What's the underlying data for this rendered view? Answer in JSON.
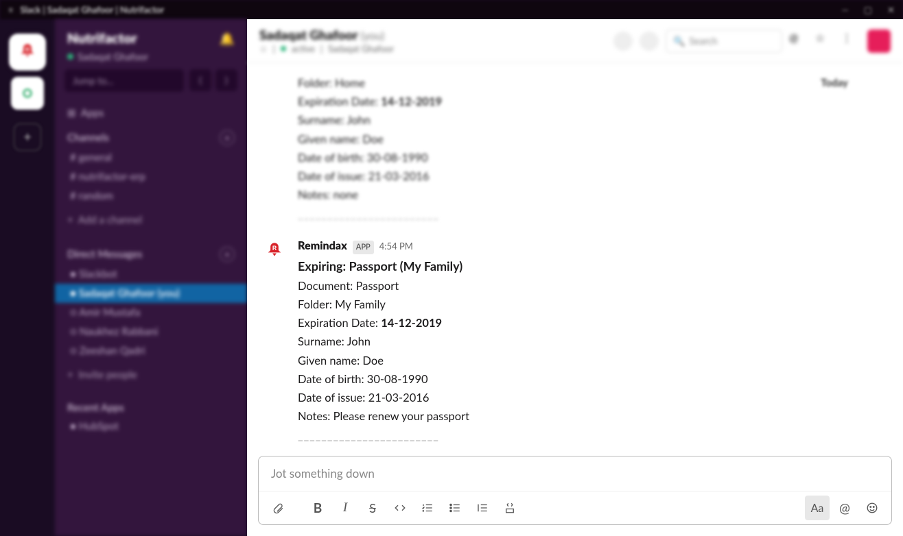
{
  "titlebar": {
    "text": "Slack | Sadaqat Ghafoor | Nutrifactor"
  },
  "workspace": {
    "name": "Nutrifactor",
    "user": "Sadaqat Ghafoor",
    "jump_placeholder": "Jump to...",
    "apps_label": "Apps"
  },
  "sidebar": {
    "channels_label": "Channels",
    "channels": [
      "general",
      "nutrifactor-erp",
      "random"
    ],
    "add_channel": "Add a channel",
    "dm_label": "Direct Messages",
    "dms": [
      {
        "name": "Slackbot",
        "presence": "active"
      },
      {
        "name": "Sadaqat Ghafoor",
        "suffix": "(you)",
        "selected": true,
        "presence": "active"
      },
      {
        "name": "Amir Mustafa",
        "presence": "away"
      },
      {
        "name": "Naukhez Rabbani",
        "presence": "away"
      },
      {
        "name": "Zeeshan Qadri",
        "presence": "away"
      }
    ],
    "invite": "Invite people",
    "recent_label": "Recent Apps",
    "recent": [
      "HubSpot"
    ]
  },
  "header": {
    "title": "Sadaqat Ghafoor",
    "you": "(you)",
    "status": "active",
    "subtitle": "Sadaqat Ghafoor",
    "search_placeholder": "Search"
  },
  "today_label": "Today",
  "prev_message": {
    "lines": [
      {
        "label": "Folder",
        "value": "Home"
      },
      {
        "label": "Expiration Date",
        "value": "14-12-2019",
        "bold_value": true
      },
      {
        "label": "Surname",
        "value": "John"
      },
      {
        "label": "Given name",
        "value": "Doe"
      },
      {
        "label": "Date of birth",
        "value": "30-08-1990"
      },
      {
        "label": "Date of issue",
        "value": "21-03-2016"
      },
      {
        "label": "Notes",
        "value": "none"
      }
    ],
    "separator": "________________________"
  },
  "message": {
    "sender": "Remindax",
    "badge": "APP",
    "time": "4:54 PM",
    "title": "Expiring: Passport (My Family)",
    "lines": [
      {
        "label": "Document",
        "value": "Passport"
      },
      {
        "label": "Folder",
        "value": "My Family"
      },
      {
        "label": "Expiration Date",
        "value": "14-12-2019",
        "bold_value": true
      },
      {
        "label": "Surname",
        "value": "John"
      },
      {
        "label": "Given name",
        "value": "Doe"
      },
      {
        "label": "Date of birth",
        "value": "30-08-1990"
      },
      {
        "label": "Date of issue",
        "value": "21-03-2016"
      },
      {
        "label": "Notes",
        "value": "Please renew your passport"
      }
    ],
    "separator": "________________________"
  },
  "composer": {
    "placeholder": "Jot something down"
  }
}
